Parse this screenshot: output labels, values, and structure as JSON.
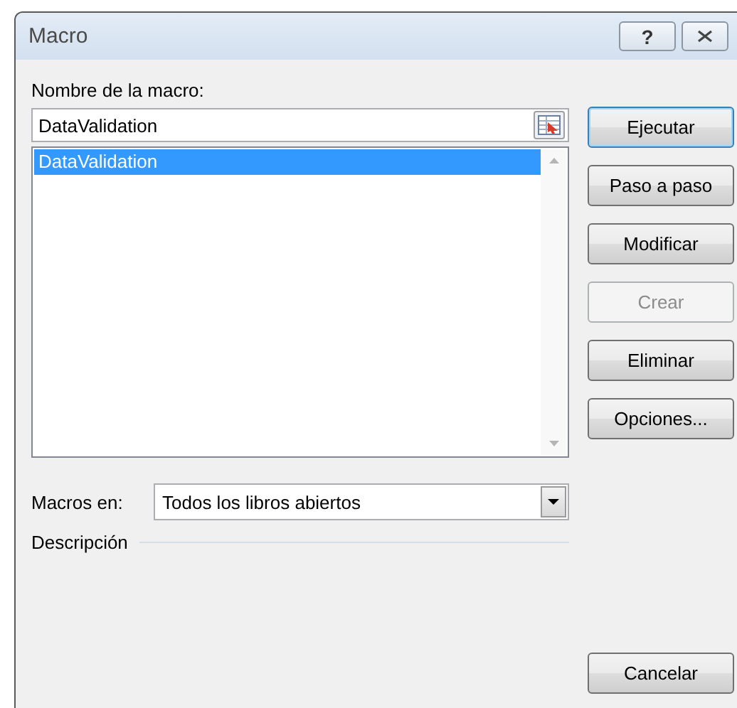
{
  "window": {
    "title": "Macro",
    "help_button": "?"
  },
  "macro_name": {
    "label": "Nombre de la macro:",
    "value": "DataValidation"
  },
  "macro_list": [
    {
      "name": "DataValidation",
      "selected": true
    }
  ],
  "buttons": [
    {
      "label": "Ejecutar",
      "disabled": false,
      "default": true
    },
    {
      "label": "Paso a paso",
      "disabled": false,
      "default": false
    },
    {
      "label": "Modificar",
      "disabled": false,
      "default": false
    },
    {
      "label": "Crear",
      "disabled": true,
      "default": false
    },
    {
      "label": "Eliminar",
      "disabled": false,
      "default": false
    },
    {
      "label": "Opciones...",
      "disabled": false,
      "default": false
    }
  ],
  "macros_in": {
    "label": "Macros en:",
    "value": "Todos los libros abiertos"
  },
  "description": {
    "label": "Descripción"
  },
  "cancel_button": {
    "label": "Cancelar"
  }
}
